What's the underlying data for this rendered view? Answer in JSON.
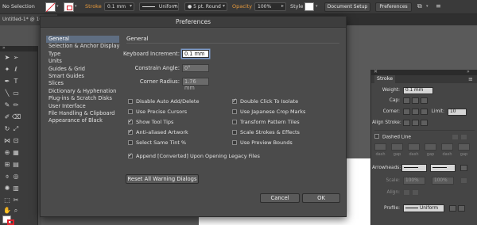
{
  "control_bar": {
    "selection_status": "No Selection",
    "stroke_label": "Stroke",
    "stroke_weight": "0.1 mm",
    "profile_value": "Uniform",
    "brush_value": "5 pt. Round",
    "opacity_label": "Opacity",
    "opacity_value": "100%",
    "style_label": "Style",
    "document_setup_label": "Document Setup",
    "preferences_label": "Preferences",
    "accent_color": "#e89a3c"
  },
  "document_tab": {
    "title": "Untitled-1* @ 100%"
  },
  "preferences_dialog": {
    "title": "Preferences",
    "categories": [
      "General",
      "Selection & Anchor Display",
      "Type",
      "Units",
      "Guides & Grid",
      "Smart Guides",
      "Slices",
      "Dictionary & Hyphenation",
      "Plug-ins & Scratch Disks",
      "User Interface",
      "File Handling & Clipboard",
      "Appearance of Black"
    ],
    "selected_category": "General",
    "section_title": "General",
    "fields": {
      "keyboard_increment_label": "Keyboard Increment:",
      "keyboard_increment_value": "0.1 mm",
      "constrain_angle_label": "Constrain Angle:",
      "constrain_angle_value": "0°",
      "corner_radius_label": "Corner Radius:",
      "corner_radius_value": "1.76 mm"
    },
    "options_left": [
      {
        "label": "Disable Auto Add/Delete",
        "checked": false
      },
      {
        "label": "Use Precise Cursors",
        "checked": false
      },
      {
        "label": "Show Tool Tips",
        "checked": true
      },
      {
        "label": "Anti-aliased Artwork",
        "checked": true
      },
      {
        "label": "Select Same Tint %",
        "checked": false
      }
    ],
    "options_right": [
      {
        "label": "Double Click To Isolate",
        "checked": true
      },
      {
        "label": "Use Japanese Crop Marks",
        "checked": false
      },
      {
        "label": "Transform Pattern Tiles",
        "checked": false
      },
      {
        "label": "Scale Strokes & Effects",
        "checked": false
      },
      {
        "label": "Use Preview Bounds",
        "checked": false
      }
    ],
    "append_option": {
      "label": "Append [Converted] Upon Opening Legacy Files",
      "checked": true
    },
    "reset_warnings_label": "Reset All Warning Dialogs",
    "cancel_label": "Cancel",
    "ok_label": "OK",
    "selection_color": "#5f6e82"
  },
  "stroke_panel": {
    "tab_label": "Stroke",
    "weight_label": "Weight:",
    "weight_value": "0.1 mm",
    "cap_label": "Cap:",
    "corner_label": "Corner:",
    "limit_label": "Limit:",
    "limit_value": "10",
    "align_label": "Align Stroke:",
    "dashed_line_label": "Dashed Line",
    "dashed_line_checked": false,
    "dash_labels": [
      "dash",
      "gap",
      "dash",
      "gap",
      "dash",
      "gap"
    ],
    "arrowheads_label": "Arrowheads:",
    "scale_label": "Scale:",
    "scale_start": "100%",
    "scale_end": "100%",
    "align_arrow_label": "Align:",
    "profile_label": "Profile:",
    "profile_value": "Uniform"
  }
}
